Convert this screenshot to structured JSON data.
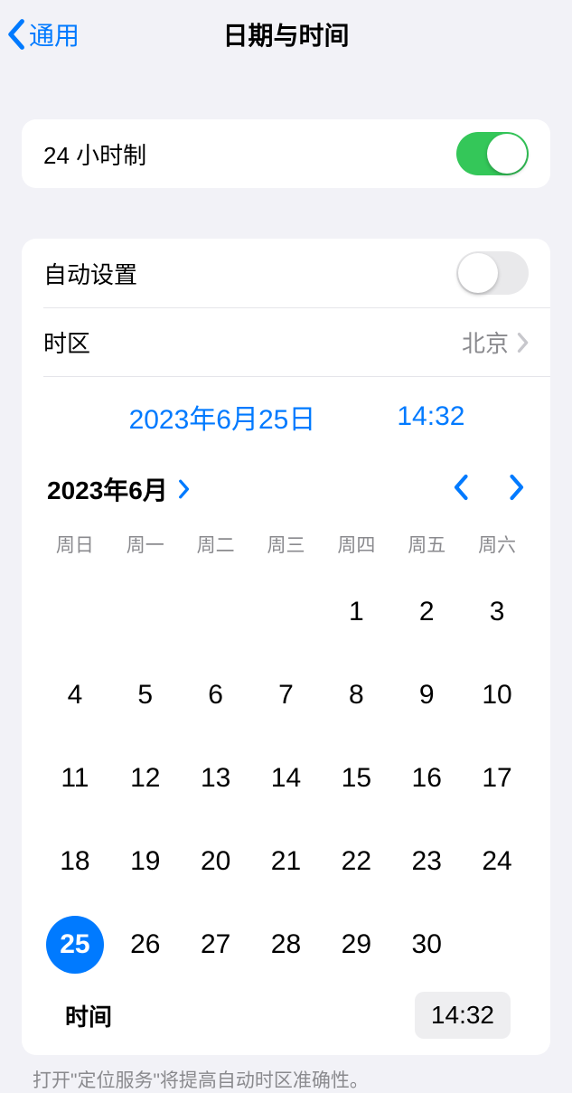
{
  "nav": {
    "back": "通用",
    "title": "日期与时间"
  },
  "s1": {
    "hour24_label": "24 小时制",
    "hour24_on": true
  },
  "s2": {
    "auto_label": "自动设置",
    "tz_label": "时区",
    "tz_value": "北京",
    "date_pill": "2023年6月25日",
    "time_pill": "14:32"
  },
  "cal": {
    "month_label": "2023年6月",
    "weekdays": [
      "周日",
      "周一",
      "周二",
      "周三",
      "周四",
      "周五",
      "周六"
    ],
    "leading_blanks": 4,
    "days_in_month": 30,
    "selected": 25,
    "time_label": "时间",
    "time_value": "14:32"
  },
  "footer": "打开\"定位服务\"将提高自动时区准确性。"
}
